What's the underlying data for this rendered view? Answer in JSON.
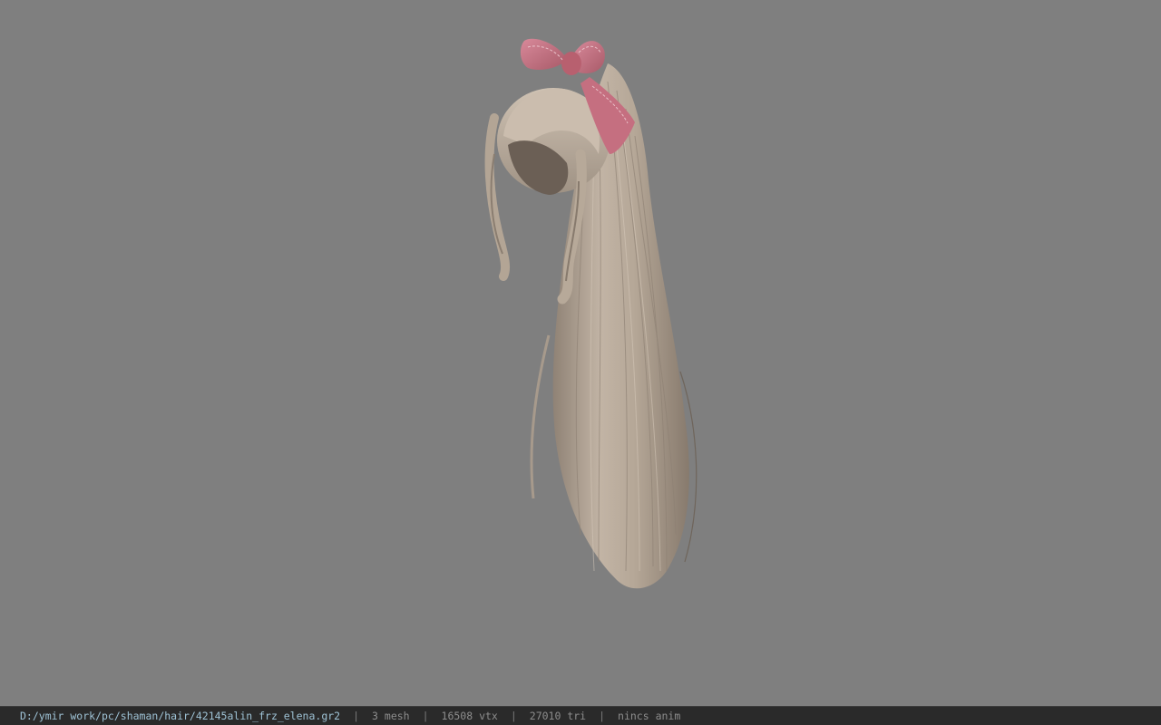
{
  "viewport": {
    "background_color": "#7f7f7f",
    "model_subject": "long ponytail hair mesh with pink bow",
    "hair_color": "#b8aa9b",
    "bow_color": "#c9747f"
  },
  "status_bar": {
    "file_path": "D:/ymir work/pc/shaman/hair/42145alin_frz_elena.gr2",
    "separator": "|",
    "mesh_count": "3 mesh",
    "vertex_count": "16508 vtx",
    "triangle_count": "27010 tri",
    "anim_status": "nincs anim"
  }
}
